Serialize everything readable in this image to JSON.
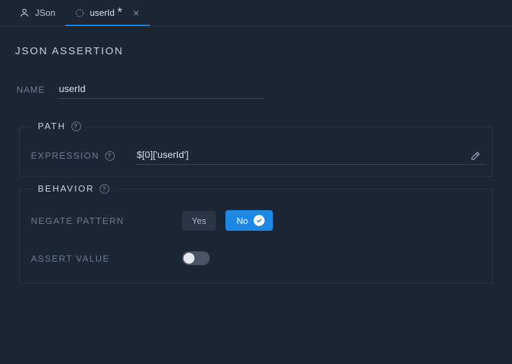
{
  "tabs": [
    {
      "label": "JSon",
      "active": false,
      "modified": false
    },
    {
      "label": "userId",
      "active": true,
      "modified": true
    }
  ],
  "page_title": "JSON ASSERTION",
  "name_section": {
    "label": "NAME",
    "value": "userId"
  },
  "path_section": {
    "legend": "PATH",
    "expression_label": "EXPRESSION",
    "expression_value": "$[0]['userId']"
  },
  "behavior_section": {
    "legend": "BEHAVIOR",
    "negate_label": "NEGATE PATTERN",
    "negate_options": {
      "yes": "Yes",
      "no": "No"
    },
    "negate_selected": "No",
    "assert_label": "ASSERT VALUE",
    "assert_value": false
  }
}
